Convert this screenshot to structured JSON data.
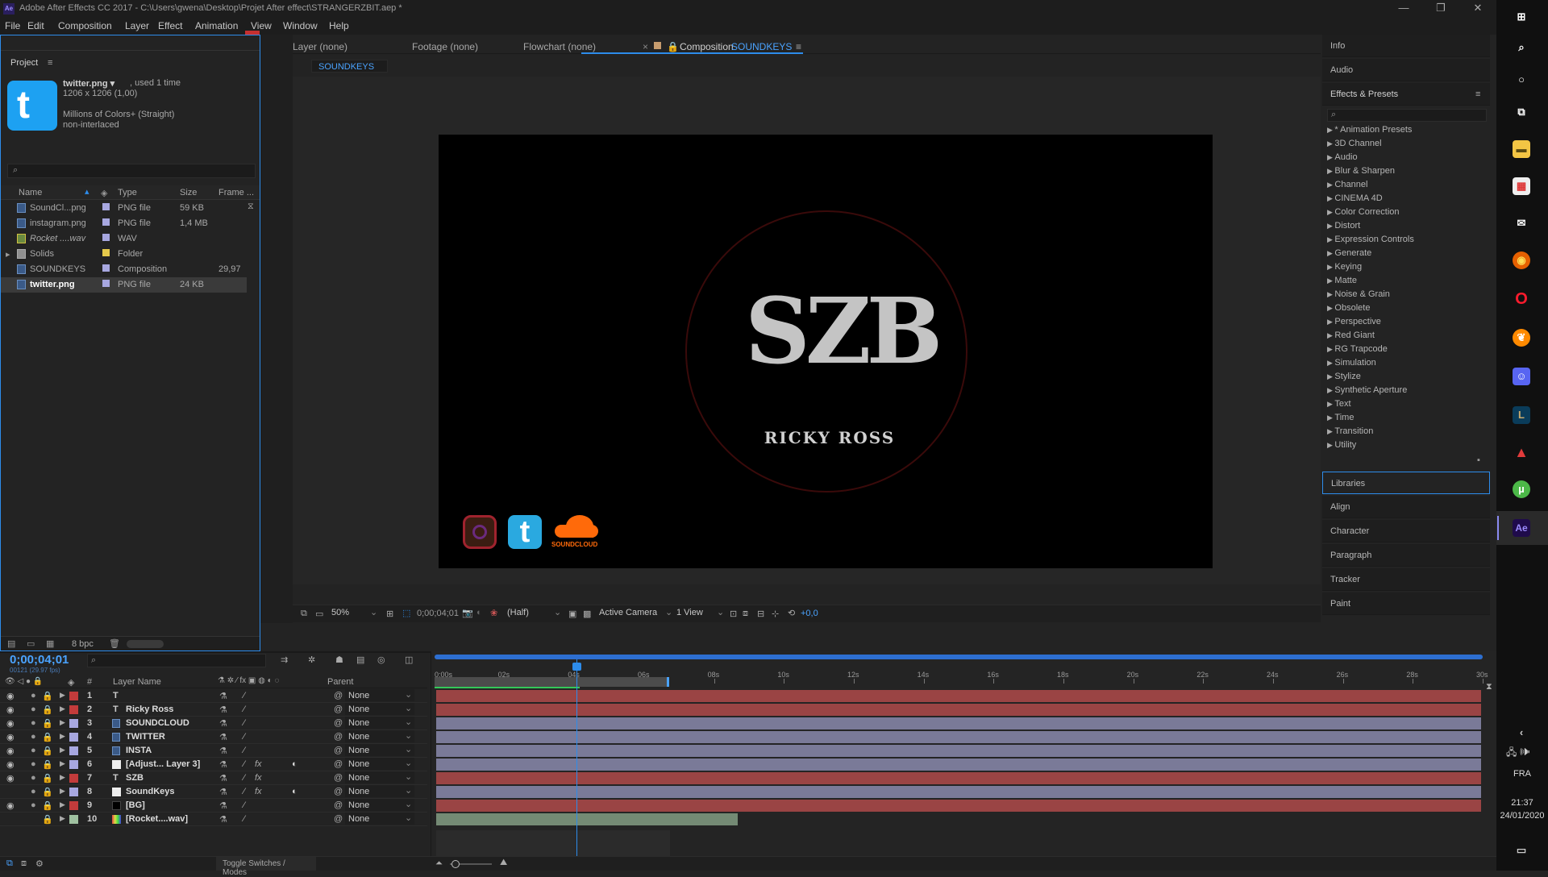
{
  "titlebar": {
    "app_badge": "Ae",
    "title": "Adobe After Effects CC 2017 - C:\\Users\\gwena\\Desktop\\Projet After effect\\STRANGERZBIT.aep *",
    "minimize": "—",
    "maximize": "❐",
    "close": "✕"
  },
  "menubar": {
    "items": [
      "File",
      "Edit",
      "Composition",
      "Layer",
      "Effect",
      "Animation",
      "View",
      "Window",
      "Help"
    ]
  },
  "project": {
    "tab_label": "Project",
    "menu_icon": "hamburger-icon",
    "close_label": "x",
    "preview_name": "twitter.png ▾",
    "preview_used": ", used 1 time",
    "preview_dims": "1206 x 1206 (1,00)",
    "preview_colors": "Millions of Colors+ (Straight)",
    "preview_interlace": "non-interlaced",
    "search_icon": "search-icon",
    "columns": {
      "name": "Name",
      "type": "Type",
      "size": "Size",
      "frame": "Frame ..."
    },
    "items": [
      {
        "name": "SoundCl...png",
        "type": "PNG file",
        "size": "59 KB",
        "frame": "",
        "label_color": "#a7a7e0",
        "kind": "png"
      },
      {
        "name": "instagram.png",
        "type": "PNG file",
        "size": "1,4 MB",
        "frame": "",
        "label_color": "#a7a7e0",
        "kind": "png"
      },
      {
        "name": "Rocket ....wav",
        "type": "WAV",
        "size": "",
        "frame": "",
        "label_color": "#a7a7e0",
        "kind": "wav"
      },
      {
        "name": "Solids",
        "type": "Folder",
        "size": "",
        "frame": "",
        "label_color": "#e5c94b",
        "kind": "folder"
      },
      {
        "name": "SOUNDKEYS",
        "type": "Composition",
        "size": "",
        "frame": "29,97",
        "label_color": "#a7a7e0",
        "kind": "comp"
      },
      {
        "name": "twitter.png",
        "type": "PNG file",
        "size": "24 KB",
        "frame": "",
        "label_color": "#a7a7e0",
        "kind": "png"
      }
    ],
    "bpc": "8 bpc"
  },
  "viewer": {
    "tabs": {
      "layer": "Layer (none)",
      "footage": "Footage (none)",
      "flowchart": "Flowchart (none)",
      "comp_prefix": "Composition",
      "comp_name": "SOUNDKEYS"
    },
    "breadcrumb": "SOUNDKEYS",
    "logo_text": "SZB",
    "artist_name": "RICKY ROSS",
    "soundcloud_label": "SOUNDCLOUD",
    "controls": {
      "zoom": "50%",
      "timecode": "0;00;04;01",
      "resolution": "(Half)",
      "camera": "Active Camera",
      "views": "1 View",
      "exposure": "+0,0"
    }
  },
  "right_panels": {
    "top": [
      "Info",
      "Audio"
    ],
    "effects_title": "Effects & Presets",
    "effects": [
      "* Animation Presets",
      "3D Channel",
      "Audio",
      "Blur & Sharpen",
      "Channel",
      "CINEMA 4D",
      "Color Correction",
      "Distort",
      "Expression Controls",
      "Generate",
      "Keying",
      "Matte",
      "Noise & Grain",
      "Obsolete",
      "Perspective",
      "Red Giant",
      "RG Trapcode",
      "Simulation",
      "Stylize",
      "Synthetic Aperture",
      "Text",
      "Time",
      "Transition",
      "Utility"
    ],
    "bottom": [
      "Libraries",
      "Align",
      "Character",
      "Paragraph",
      "Tracker",
      "Paint"
    ]
  },
  "timeline": {
    "timecode": "0;00;04;01",
    "fps": "00121 (29.97 fps)",
    "col_layer_name": "Layer Name",
    "col_parent": "Parent",
    "col_num": "#",
    "ruler": [
      "0:00s",
      "02s",
      "04s",
      "06s",
      "08s",
      "10s",
      "12s",
      "14s",
      "16s",
      "18s",
      "20s",
      "22s",
      "24s",
      "26s",
      "28s",
      "30s"
    ],
    "layers": [
      {
        "num": "1",
        "type": "T",
        "name": "",
        "label_color": "#c23b3b",
        "bar_color": "#9a4444",
        "parent": "None",
        "fx": false,
        "vis": true
      },
      {
        "num": "2",
        "type": "T",
        "name": "Ricky Ross",
        "label_color": "#c23b3b",
        "bar_color": "#9a4444",
        "parent": "None",
        "fx": false,
        "vis": true
      },
      {
        "num": "3",
        "type": "img",
        "name": "SOUNDCLOUD",
        "label_color": "#a7a7e0",
        "bar_color": "#7a7a98",
        "parent": "None",
        "fx": false,
        "vis": true
      },
      {
        "num": "4",
        "type": "img",
        "name": "TWITTER",
        "label_color": "#a7a7e0",
        "bar_color": "#7a7a98",
        "parent": "None",
        "fx": false,
        "vis": true
      },
      {
        "num": "5",
        "type": "img",
        "name": "INSTA",
        "label_color": "#a7a7e0",
        "bar_color": "#7a7a98",
        "parent": "None",
        "fx": false,
        "vis": true
      },
      {
        "num": "6",
        "type": "solid",
        "name": "[Adjust... Layer 3]",
        "label_color": "#a7a7e0",
        "bar_color": "#7a7a98",
        "parent": "None",
        "fx": true,
        "vis": true
      },
      {
        "num": "7",
        "type": "T",
        "name": "SZB",
        "label_color": "#c23b3b",
        "bar_color": "#9a4444",
        "parent": "None",
        "fx": true,
        "vis": true
      },
      {
        "num": "8",
        "type": "solid",
        "name": "SoundKeys",
        "label_color": "#a7a7e0",
        "bar_color": "#7a7a98",
        "parent": "None",
        "fx": true,
        "vis": false
      },
      {
        "num": "9",
        "type": "black",
        "name": "[BG]",
        "label_color": "#c23b3b",
        "bar_color": "#9a4444",
        "parent": "None",
        "fx": false,
        "vis": true
      },
      {
        "num": "10",
        "type": "wav",
        "name": "[Rocket....wav]",
        "label_color": "#9fc0a0",
        "bar_color": "#748a74",
        "parent": "None",
        "fx": false,
        "vis": false
      }
    ],
    "toggle_label": "Toggle Switches / Modes"
  },
  "taskbar": {
    "lang": "FRA",
    "time": "21:37",
    "date": "24/01/2020"
  }
}
